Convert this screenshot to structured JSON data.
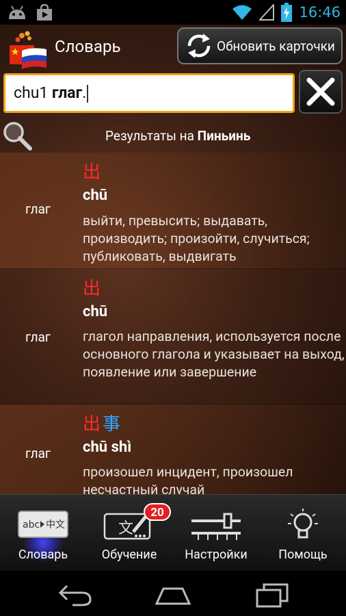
{
  "status_bar": {
    "time": "16:46",
    "icons": [
      "android-icon",
      "play-store-icon",
      "wifi-icon",
      "signal-icon",
      "battery-charging-icon"
    ]
  },
  "header": {
    "title": "Словарь",
    "refresh_button": "Обновить карточки"
  },
  "search": {
    "value_plain": "chu1 ",
    "value_bold": "глаг",
    "value_suffix": "."
  },
  "results": {
    "prefix": "Результаты на ",
    "mode": "Пиньинь"
  },
  "entries": [
    {
      "pos": "глаг",
      "hanzi": [
        {
          "char": "出",
          "tone_color": "red"
        }
      ],
      "pinyin": "chū",
      "meaning": "выйти, превысить; выдавать, производить; произойти, случиться; публиковать, выдвигать"
    },
    {
      "pos": "глаг",
      "hanzi": [
        {
          "char": "出",
          "tone_color": "red"
        }
      ],
      "pinyin": "chū",
      "meaning": "глагол направления, используется после основного глагола и указывает на выход, появление или завершение"
    },
    {
      "pos": "глаг",
      "hanzi": [
        {
          "char": "出",
          "tone_color": "red"
        },
        {
          "char": "事",
          "tone_color": "blue"
        }
      ],
      "pinyin": "chū shì",
      "meaning": "произошел инцидент, произошел несчастный случай"
    }
  ],
  "tabs": [
    {
      "label": "Словарь",
      "icon": "dictionary-icon",
      "active": true
    },
    {
      "label": "Обучение",
      "icon": "flashcards-icon",
      "badge": "20"
    },
    {
      "label": "Настройки",
      "icon": "settings-sliders-icon"
    },
    {
      "label": "Помощь",
      "icon": "lightbulb-icon"
    }
  ],
  "colors": {
    "accent_orange": "#f0a21a",
    "tone_red": "#ff2a2a",
    "tone_blue": "#2fa8ff",
    "status_blue": "#33b5e5"
  }
}
